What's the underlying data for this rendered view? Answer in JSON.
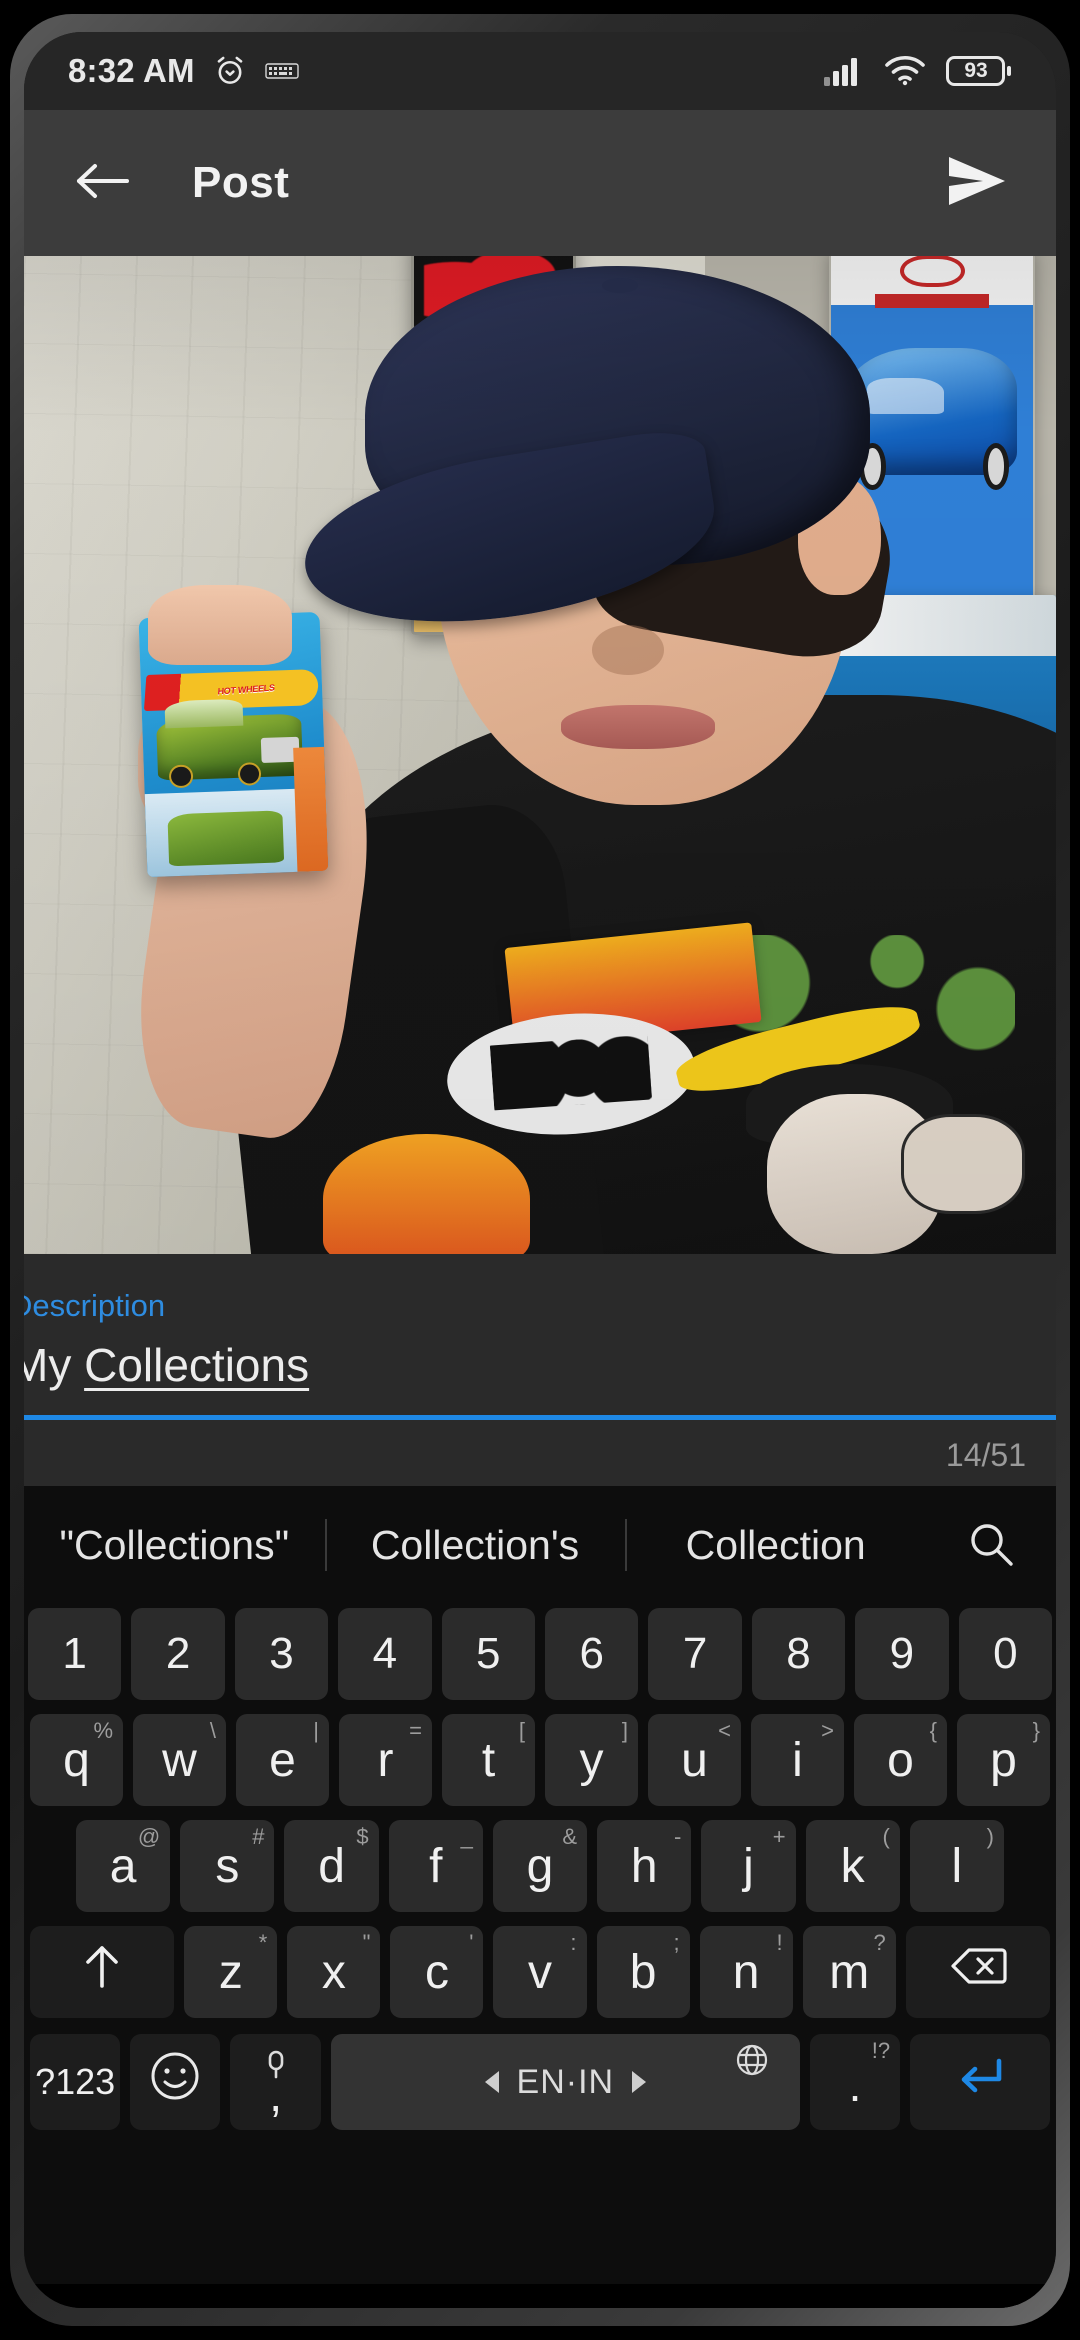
{
  "statusbar": {
    "time": "8:32 AM",
    "icons_left": [
      "alarm-icon",
      "keyboard-active-icon"
    ],
    "icons_right": [
      "signal-icon",
      "wifi-icon",
      "battery-icon"
    ],
    "battery_level": "93"
  },
  "appbar": {
    "back_icon": "back-arrow-icon",
    "title": "Post",
    "send_icon": "send-icon"
  },
  "photo": {
    "alt": "Boy in navy cap and black Ben 10 t-shirt holding a Hot Wheels blister pack",
    "brand_text": "HOT WHEELS"
  },
  "description_field": {
    "label": "Description",
    "value": "My Collections",
    "value_prefix": "My ",
    "value_misspelled": "Collections",
    "counter": "14/51",
    "accent_color": "#1e88e5",
    "label_color": "#2e8ce0"
  },
  "keyboard": {
    "suggestions": [
      "\"Collections\"",
      "Collection's",
      "Collection"
    ],
    "search_icon": "search-icon",
    "row_numbers": [
      "1",
      "2",
      "3",
      "4",
      "5",
      "6",
      "7",
      "8",
      "9",
      "0"
    ],
    "row_q": [
      {
        "main": "q",
        "sub": "%"
      },
      {
        "main": "w",
        "sub": "\\"
      },
      {
        "main": "e",
        "sub": "|"
      },
      {
        "main": "r",
        "sub": "="
      },
      {
        "main": "t",
        "sub": "["
      },
      {
        "main": "y",
        "sub": "]"
      },
      {
        "main": "u",
        "sub": "<"
      },
      {
        "main": "i",
        "sub": ">"
      },
      {
        "main": "o",
        "sub": "{"
      },
      {
        "main": "p",
        "sub": "}"
      }
    ],
    "row_a": [
      {
        "main": "a",
        "sub": "@"
      },
      {
        "main": "s",
        "sub": "#"
      },
      {
        "main": "d",
        "sub": "$"
      },
      {
        "main": "f",
        "sub": "_"
      },
      {
        "main": "g",
        "sub": "&"
      },
      {
        "main": "h",
        "sub": "-"
      },
      {
        "main": "j",
        "sub": "+"
      },
      {
        "main": "k",
        "sub": "("
      },
      {
        "main": "l",
        "sub": ")"
      }
    ],
    "row_z": [
      {
        "main": "z",
        "sub": "*"
      },
      {
        "main": "x",
        "sub": "\""
      },
      {
        "main": "c",
        "sub": "'"
      },
      {
        "main": "v",
        "sub": ":"
      },
      {
        "main": "b",
        "sub": ";"
      },
      {
        "main": "n",
        "sub": "!"
      },
      {
        "main": "m",
        "sub": "?"
      }
    ],
    "shift_icon": "shift-arrow-icon",
    "backspace_icon": "backspace-icon",
    "symbols_key": "?123",
    "emoji_icon": "emoji-smiley-icon",
    "comma_key": ",",
    "mic_icon": "microphone-icon",
    "space_label": "EN·IN",
    "globe_icon": "globe-icon",
    "period_key": ".",
    "period_sub": "!?",
    "enter_icon": "enter-icon",
    "enter_color": "#1e88e5"
  }
}
